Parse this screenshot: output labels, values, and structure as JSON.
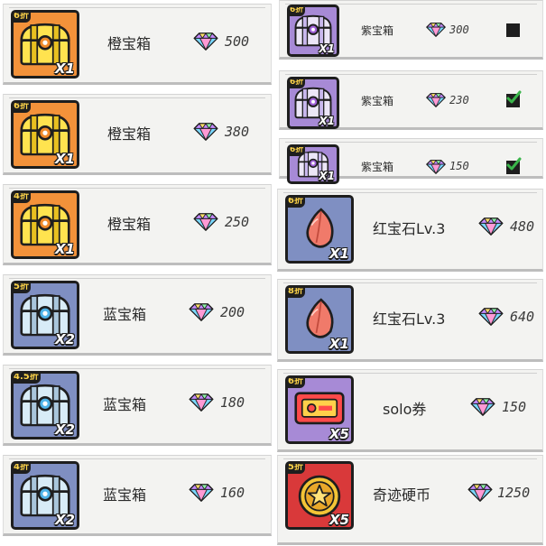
{
  "colors": {
    "orange": "#f3923a",
    "blue": "#7f8fc2",
    "purple": "#a78ad6",
    "red": "#d9393a",
    "gem": "#b46cff"
  },
  "left": [
    {
      "discount": "6折",
      "qty": "X1",
      "name": "橙宝箱",
      "price": "500",
      "chest": "orange",
      "bg": "#f3923a"
    },
    {
      "discount": "6折",
      "qty": "X1",
      "name": "橙宝箱",
      "price": "380",
      "chest": "orange",
      "bg": "#f3923a"
    },
    {
      "discount": "4折",
      "qty": "X1",
      "name": "橙宝箱",
      "price": "250",
      "chest": "orange",
      "bg": "#f3923a"
    },
    {
      "discount": "5折",
      "qty": "X2",
      "name": "蓝宝箱",
      "price": "200",
      "chest": "blue",
      "bg": "#7f8fc2"
    },
    {
      "discount": "4.5折",
      "qty": "X2",
      "name": "蓝宝箱",
      "price": "180",
      "chest": "blue",
      "bg": "#7f8fc2"
    },
    {
      "discount": "4折",
      "qty": "X2",
      "name": "蓝宝箱",
      "price": "160",
      "chest": "blue",
      "bg": "#7f8fc2"
    }
  ],
  "right_top": [
    {
      "discount": "6折",
      "qty": "X1",
      "name": "紫宝箱",
      "price": "300",
      "checked": false
    },
    {
      "discount": "6折",
      "qty": "X1",
      "name": "紫宝箱",
      "price": "230",
      "checked": true
    },
    {
      "discount": "6折",
      "qty": "X1",
      "name": "紫宝箱",
      "price": "150",
      "checked": true
    }
  ],
  "right": [
    {
      "discount": "6折",
      "qty": "X1",
      "name": "红宝石Lv.3",
      "price": "480",
      "item": "ruby",
      "bg": "#7f8fc2"
    },
    {
      "discount": "8折",
      "qty": "X1",
      "name": "红宝石Lv.3",
      "price": "640",
      "item": "ruby",
      "bg": "#7f8fc2"
    },
    {
      "discount": "6折",
      "qty": "X5",
      "name": "solo券",
      "price": "150",
      "item": "ticket",
      "bg": "#a78ad6"
    },
    {
      "discount": "5折",
      "qty": "X5",
      "name": "奇迹硬币",
      "price": "1250",
      "item": "coin",
      "bg": "#d9393a"
    }
  ]
}
